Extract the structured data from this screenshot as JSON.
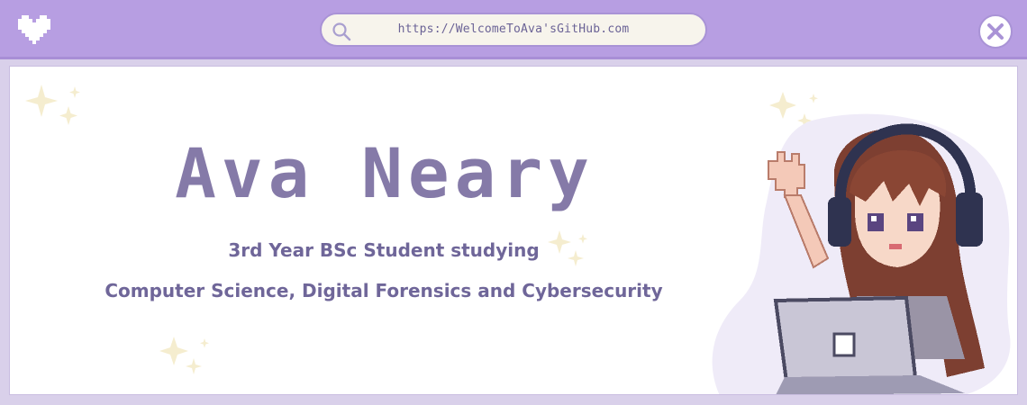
{
  "window": {
    "url": "https://WelcomeToAva'sGitHub.com"
  },
  "icons": {
    "favorite": "heart-icon",
    "search": "search-icon",
    "close": "close-icon"
  },
  "banner": {
    "name": "Ava Neary",
    "subtitle_line1": "3rd Year BSc Student studying",
    "subtitle_line2": "Computer Science, Digital Forensics and Cybersecurity"
  },
  "colors": {
    "titlebar": "#b79ee2",
    "name_text": "#857aa8",
    "subtitle_text": "#6f6699",
    "sparkle": "#f5edcf"
  }
}
